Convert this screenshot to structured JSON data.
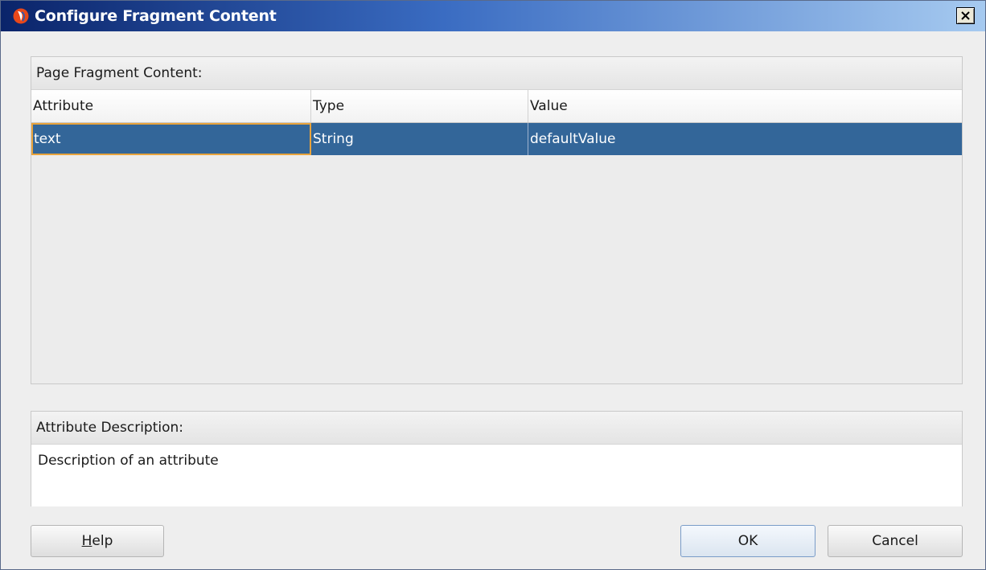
{
  "window": {
    "title": "Configure Fragment Content",
    "icon": "oracle-jdeveloper-icon",
    "close_glyph": "✕"
  },
  "content_panel": {
    "heading": "Page Fragment Content:",
    "columns": [
      "Attribute",
      "Type",
      "Value"
    ],
    "rows": [
      {
        "attribute": "text",
        "type": "String",
        "value": "defaultValue",
        "selected": true
      }
    ]
  },
  "description_panel": {
    "heading": "Attribute Description:",
    "text": "Description of an attribute"
  },
  "buttons": {
    "help": {
      "mnemonic": "H",
      "rest": "elp"
    },
    "ok": "OK",
    "cancel": "Cancel"
  },
  "colors": {
    "selection": "#336699",
    "focus_border": "#e8a33c",
    "title_gradient_start": "#0a246a",
    "title_gradient_end": "#a6caf0"
  }
}
